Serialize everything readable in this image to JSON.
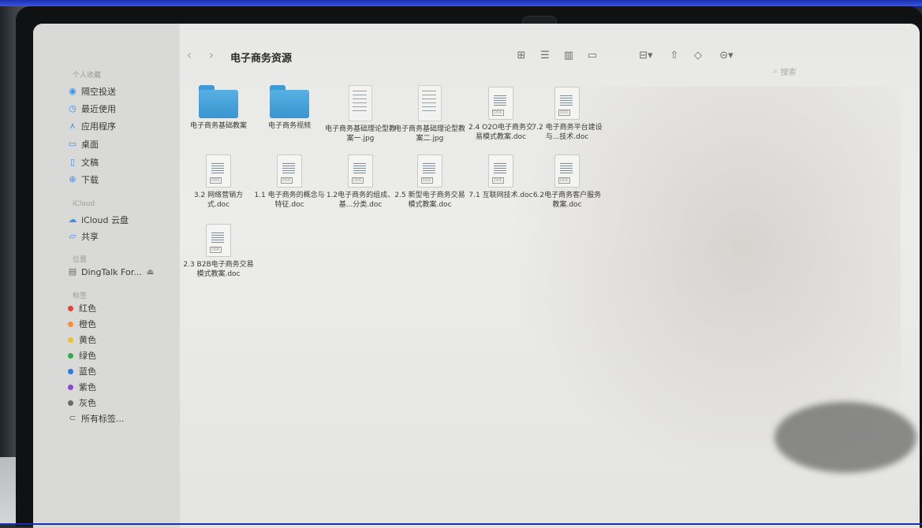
{
  "window": {
    "title": "电子商务资源"
  },
  "sidebar": {
    "sections": [
      {
        "label": "个人收藏",
        "items": [
          {
            "label": "隔空投送",
            "icon": "airdrop-icon"
          },
          {
            "label": "最近使用",
            "icon": "clock-icon"
          },
          {
            "label": "应用程序",
            "icon": "applications-icon"
          },
          {
            "label": "桌面",
            "icon": "desktop-icon"
          },
          {
            "label": "文稿",
            "icon": "document-icon"
          },
          {
            "label": "下载",
            "icon": "download-icon"
          }
        ]
      },
      {
        "label": "iCloud",
        "items": [
          {
            "label": "iCloud 云盘",
            "icon": "cloud-icon"
          },
          {
            "label": "共享",
            "icon": "shared-folder-icon"
          }
        ]
      },
      {
        "label": "位置",
        "items": [
          {
            "label": "DingTalk For...",
            "icon": "drive-icon"
          }
        ]
      },
      {
        "label": "标签",
        "items": [
          {
            "label": "红色",
            "color": "#e0443a"
          },
          {
            "label": "橙色",
            "color": "#f0903a"
          },
          {
            "label": "黄色",
            "color": "#e8c040"
          },
          {
            "label": "绿色",
            "color": "#3aa84a"
          },
          {
            "label": "蓝色",
            "color": "#2f7ae0"
          },
          {
            "label": "紫色",
            "color": "#8a4ac8"
          },
          {
            "label": "灰色",
            "color": "#6a6a6a"
          },
          {
            "label": "所有标签...",
            "icon": "tag-icon"
          }
        ]
      }
    ]
  },
  "toolbar": {
    "search_placeholder": "搜索"
  },
  "files": [
    {
      "name": "电子商务基础教案",
      "type": "folder"
    },
    {
      "name": "电子商务视频",
      "type": "folder"
    },
    {
      "name": "电子商务基础理论型教案一.jpg",
      "type": "jpg"
    },
    {
      "name": "电子商务基础理论型教案二.jpg",
      "type": "jpg"
    },
    {
      "name": "2.4  O2O电子商务交易模式教案.doc",
      "type": "doc"
    },
    {
      "name": "7.2  电子商务平台建设与...技术.doc",
      "type": "doc"
    },
    {
      "name": "3.2 网络营销方式.doc",
      "type": "doc"
    },
    {
      "name": "1.1 电子商务的概念与特征.doc",
      "type": "doc"
    },
    {
      "name": "1.2电子商务的组成、基...分类.doc",
      "type": "doc"
    },
    {
      "name": "2.5  新型电子商务交易模式教案.doc",
      "type": "doc"
    },
    {
      "name": "7.1  互联网技术.doc",
      "type": "doc"
    },
    {
      "name": "6.2电子商务客户服务 教案.doc",
      "type": "doc"
    },
    {
      "name": "2.3  B2B电子商务交易模式教案.doc",
      "type": "doc"
    }
  ],
  "doc_badge": "DOC"
}
